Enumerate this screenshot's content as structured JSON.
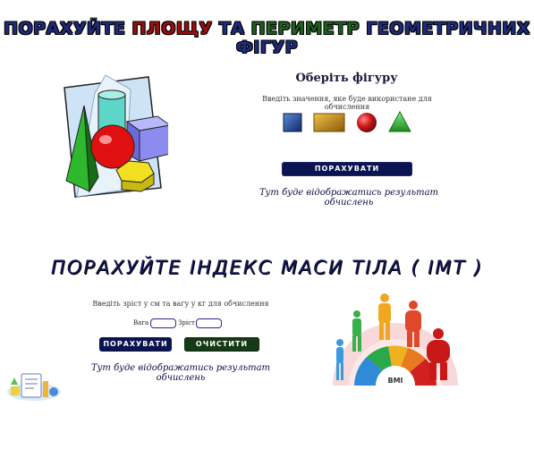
{
  "area": {
    "title_part1": "ПОРАХУЙТЕ",
    "title_part2": "ПЛОЩУ",
    "title_part3": "ТА",
    "title_part4": "ПЕРИМЕТР",
    "title_part5": "ГЕОМЕТРИЧНИХ ФІГУР",
    "choose_label": "Оберіть фігуру",
    "hint": "Введіть значення, яке буде використане для обчислення",
    "shapes": [
      {
        "name": "square",
        "color": "#1e3f8a"
      },
      {
        "name": "rectangle",
        "color": "#c48a1a"
      },
      {
        "name": "circle",
        "color": "#c01818"
      },
      {
        "name": "triangle",
        "color": "#2aa02a"
      }
    ],
    "calc_label": "ПОРАХУВАТИ",
    "result_placeholder": "Тут буде відображатись результат обчислень"
  },
  "bmi": {
    "title": "ПОРАХУЙТЕ ІНДЕКС МАСИ ТІЛА ( ІМТ )",
    "hint": "Введіть зріст у см та вагу у кг для обчислення",
    "weight_label": "Вага",
    "height_label": "Зріст",
    "calc_label": "ПОРАХУВАТИ",
    "clear_label": "ОЧИСТИТИ",
    "result_placeholder": "Тут буде відображатись результат обчислень",
    "gauge_label": "BMI"
  },
  "colors": {
    "navy_button": "#0b1450",
    "green_button": "#163a16"
  }
}
